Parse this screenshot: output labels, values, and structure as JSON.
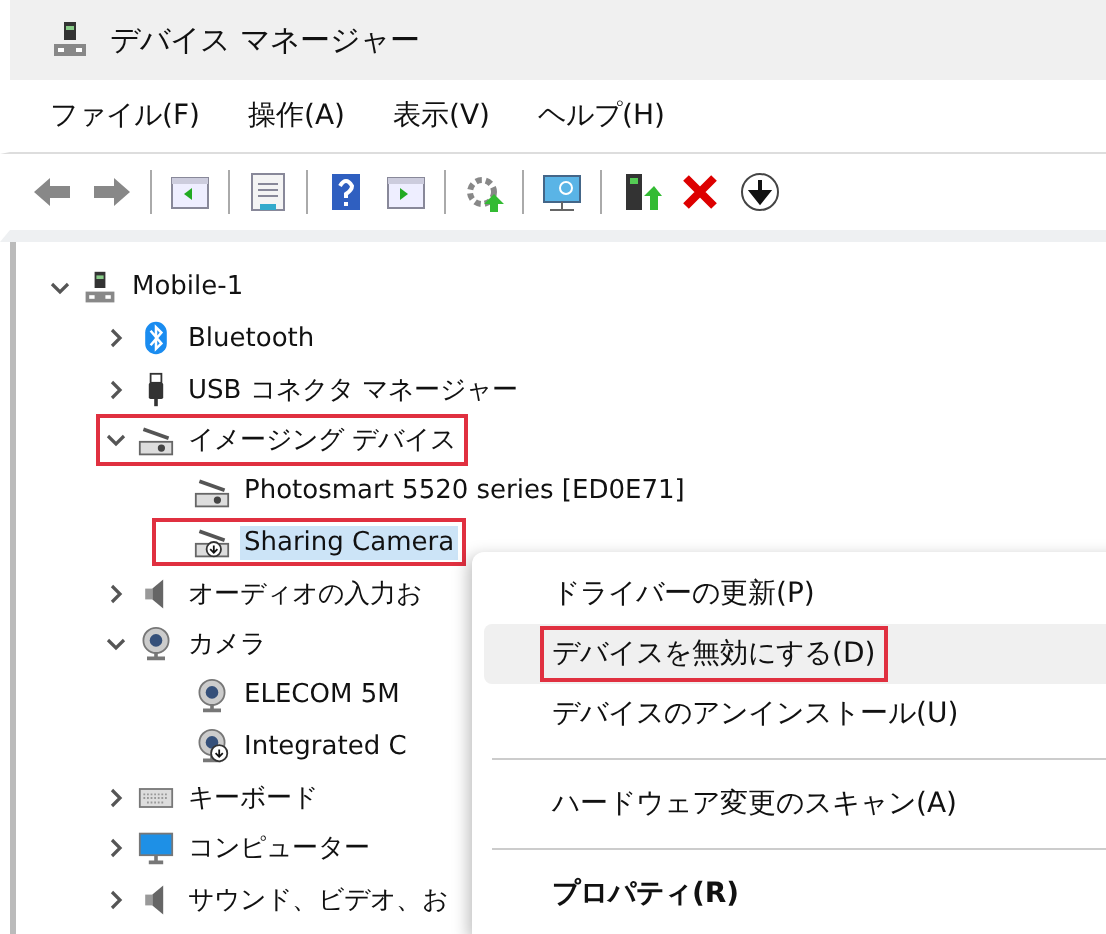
{
  "window": {
    "title": "デバイス マネージャー"
  },
  "menu_bar": [
    "ファイル(F)",
    "操作(A)",
    "表示(V)",
    "ヘルプ(H)"
  ],
  "toolbar": [
    {
      "kind": "back"
    },
    {
      "kind": "forward"
    },
    {
      "kind": "sep"
    },
    {
      "kind": "panel-left"
    },
    {
      "kind": "sep"
    },
    {
      "kind": "sheet"
    },
    {
      "kind": "sep"
    },
    {
      "kind": "help"
    },
    {
      "kind": "panel-right"
    },
    {
      "kind": "sep"
    },
    {
      "kind": "gear-up"
    },
    {
      "kind": "sep"
    },
    {
      "kind": "monitor-search"
    },
    {
      "kind": "sep"
    },
    {
      "kind": "tower-up"
    },
    {
      "kind": "delete"
    },
    {
      "kind": "down-circle"
    }
  ],
  "tree": [
    {
      "label": "Mobile-1",
      "kind": "computer",
      "expanded": true,
      "selected": false,
      "highlighted": false,
      "children": [
        {
          "label": "Bluetooth",
          "kind": "bluetooth",
          "expanded": false,
          "selected": false,
          "highlighted": false
        },
        {
          "label": "USB コネクタ マネージャー",
          "kind": "usb",
          "expanded": false,
          "selected": false,
          "highlighted": false
        },
        {
          "label": "イメージング デバイス",
          "kind": "scanner",
          "expanded": true,
          "selected": false,
          "highlighted": true,
          "children": [
            {
              "label": "Photosmart 5520 series [ED0E71]",
              "kind": "scanner",
              "selected": false,
              "highlighted": false
            },
            {
              "label": "Sharing Camera",
              "kind": "scanner-down",
              "selected": true,
              "highlighted": true
            }
          ]
        },
        {
          "label": "オーディオの入力お",
          "kind": "speaker",
          "expanded": false,
          "selected": false,
          "highlighted": false
        },
        {
          "label": "カメラ",
          "kind": "webcam",
          "expanded": true,
          "selected": false,
          "highlighted": false,
          "children": [
            {
              "label": "ELECOM 5M",
              "kind": "webcam",
              "selected": false,
              "highlighted": false
            },
            {
              "label": "Integrated C",
              "kind": "webcam-down",
              "selected": false,
              "highlighted": false
            }
          ]
        },
        {
          "label": "キーボード",
          "kind": "keyboard",
          "expanded": false,
          "selected": false,
          "highlighted": false
        },
        {
          "label": "コンピューター",
          "kind": "monitor",
          "expanded": false,
          "selected": false,
          "highlighted": false
        },
        {
          "label": "サウンド、ビデオ、お",
          "kind": "speaker",
          "expanded": false,
          "selected": false,
          "highlighted": false
        }
      ]
    }
  ],
  "context_menu": [
    {
      "kind": "item",
      "label": "ドライバーの更新(P)",
      "selected": false,
      "highlighted": false,
      "bold": false
    },
    {
      "kind": "item",
      "label": "デバイスを無効にする(D)",
      "selected": true,
      "highlighted": true,
      "bold": false
    },
    {
      "kind": "item",
      "label": "デバイスのアンインストール(U)",
      "selected": false,
      "highlighted": false,
      "bold": false
    },
    {
      "kind": "separator"
    },
    {
      "kind": "item",
      "label": "ハードウェア変更のスキャン(A)",
      "selected": false,
      "highlighted": false,
      "bold": false
    },
    {
      "kind": "separator"
    },
    {
      "kind": "item",
      "label": "プロパティ(R)",
      "selected": false,
      "highlighted": false,
      "bold": true
    }
  ]
}
